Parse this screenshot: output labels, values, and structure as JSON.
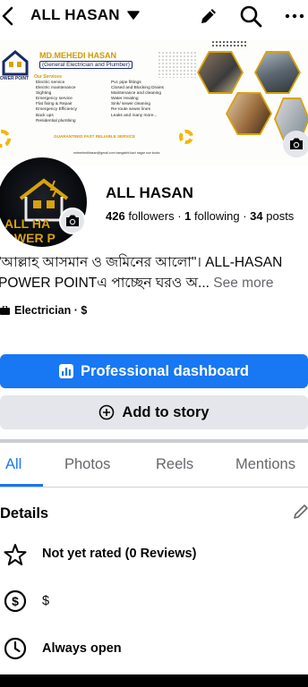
{
  "topbar": {
    "title": "ALL HASAN",
    "icons": [
      "back-icon",
      "caret-down-icon",
      "pencil-icon",
      "search-icon",
      "more-icon"
    ]
  },
  "cover": {
    "business_name": "MD.MEHEDI HASAN",
    "subtitle": "(General Electrician and Plumber)",
    "logo_text": "OWER POINT",
    "services_heading": "Our Services",
    "services_col1": [
      "Electric service",
      "Electric maintenance",
      "Sighting",
      "Emergency service",
      "Flat fixing & Repair",
      "Emergency Efficiency",
      "Back ups",
      "Residential plumbing"
    ],
    "services_col2": [
      "Pvc pipe fittings",
      "Closed and Blocking Drains",
      "Maintenance and cleaning",
      "Water Heating",
      "Sink/ sewer cleaning",
      "Re-route sewer lines",
      "Leaks and many more..."
    ],
    "guarantee": "GUARANTEED FAST RELIABLE SERVICE",
    "contacts": "mdmehedihasan@gmail.com   bangabhi kazi nagar sun koola",
    "camera_icon": "camera-icon"
  },
  "avatar": {
    "text": "ALL HA\nOWER P",
    "camera_icon": "camera-icon"
  },
  "profile": {
    "name": "ALL HASAN",
    "followers_count": "426",
    "followers_label": " followers · ",
    "following_count": "1",
    "following_label": " following · ",
    "posts_count": "34",
    "posts_label": " posts"
  },
  "bio": {
    "line1": "\"আল্লাহ আসমান ও জমিনের আলো\"। ALL-HASAN",
    "line2": "POWER POINTএ পাচ্ছেন  ঘরও অ...",
    "see_more": " See more"
  },
  "category": {
    "label": "Electrician · $",
    "icon": "briefcase-icon"
  },
  "buttons": {
    "dashboard": "Professional dashboard",
    "dashboard_icon": "chart-icon",
    "story": "Add to story",
    "story_icon": "plus-circle-icon"
  },
  "tabs": [
    {
      "label": "All",
      "active": true
    },
    {
      "label": "Photos",
      "active": false
    },
    {
      "label": "Reels",
      "active": false
    },
    {
      "label": "Mentions",
      "active": false
    }
  ],
  "details": {
    "title": "Details",
    "edit_icon": "pencil-icon",
    "rows": [
      {
        "icon": "star-icon",
        "text": "Not yet rated (0 Reviews)"
      },
      {
        "icon": "dollar-icon",
        "text": "$"
      },
      {
        "icon": "clock-icon",
        "text": "Always open"
      }
    ]
  },
  "colors": {
    "accent": "#1877f2",
    "secondary_button": "#e4e6eb",
    "muted_text": "#65676b",
    "brand_gold": "#d9a20a"
  }
}
